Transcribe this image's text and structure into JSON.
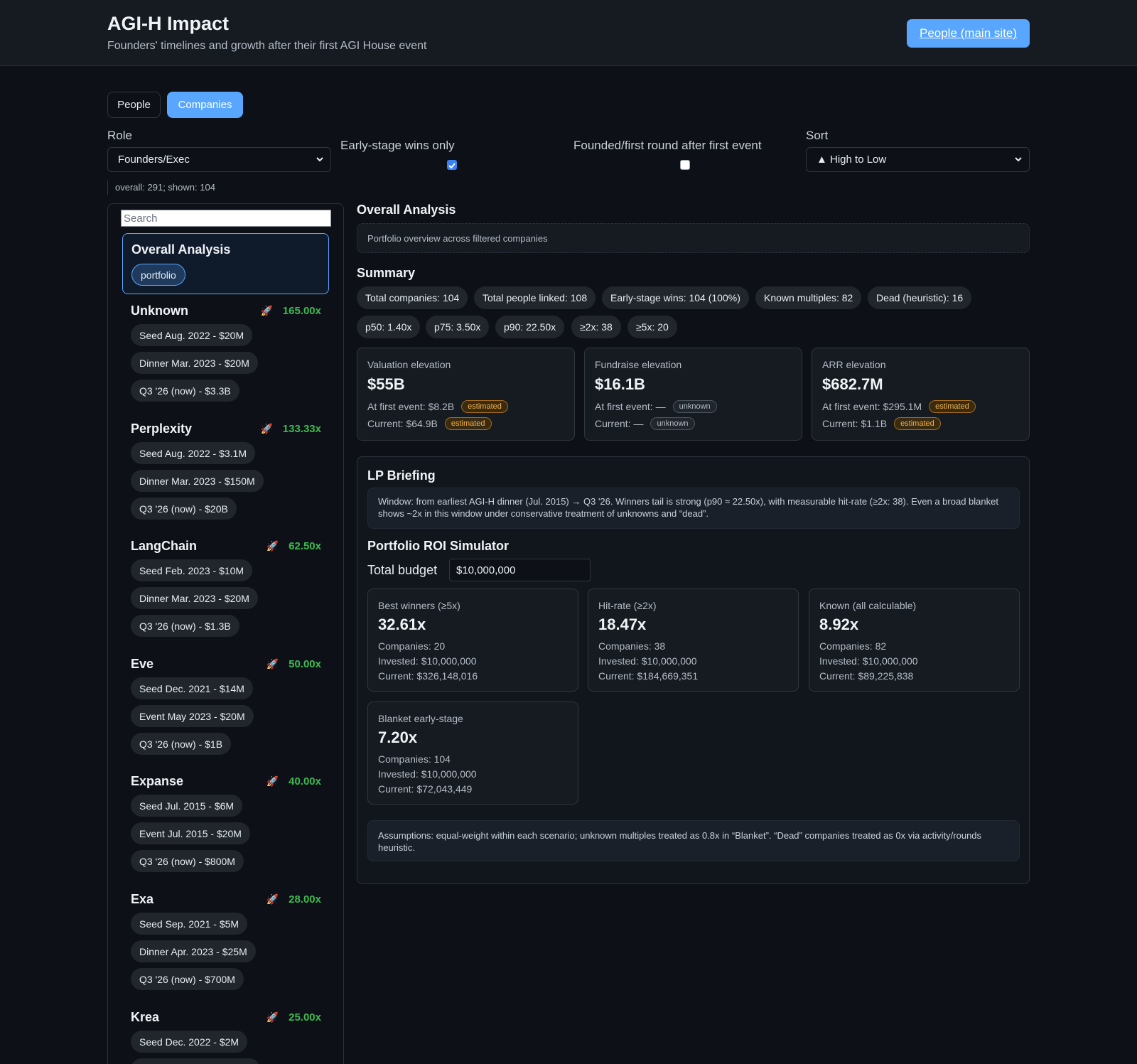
{
  "header": {
    "title": "AGI-H Impact",
    "subtitle": "Founders' timelines and growth after their first AGI House event",
    "main_site_link": "People (main site)"
  },
  "tabs": [
    {
      "label": "People",
      "active": false
    },
    {
      "label": "Companies",
      "active": true
    }
  ],
  "filters": {
    "role_label": "Role",
    "role_value": "Founders/Exec",
    "early_stage_label": "Early-stage wins only",
    "early_stage_checked": true,
    "founded_after_label": "Founded/first round after first event",
    "founded_after_checked": false,
    "sort_label": "Sort",
    "sort_value": "▲ High to Low"
  },
  "counts": "overall: 291; shown: 104",
  "sidebar": {
    "search_placeholder": "Search",
    "overall": {
      "title": "Overall Analysis",
      "tag": "portfolio"
    },
    "companies": [
      {
        "name": "Unknown",
        "multiple": "165.00x",
        "rounds": [
          "Seed Aug. 2022 - $20M",
          "Dinner Mar. 2023 - $20M",
          "Q3 '26 (now) - $3.3B"
        ]
      },
      {
        "name": "Perplexity",
        "multiple": "133.33x",
        "rounds": [
          "Seed Aug. 2022 - $3.1M",
          "Dinner Mar. 2023 - $150M",
          "Q3 '26 (now) - $20B"
        ]
      },
      {
        "name": "LangChain",
        "multiple": "62.50x",
        "rounds": [
          "Seed Feb. 2023 - $10M",
          "Dinner Mar. 2023 - $20M",
          "Q3 '26 (now) - $1.3B"
        ]
      },
      {
        "name": "Eve",
        "multiple": "50.00x",
        "rounds": [
          "Seed Dec. 2021 - $14M",
          "Event May 2023 - $20M",
          "Q3 '26 (now) - $1B"
        ]
      },
      {
        "name": "Expanse",
        "multiple": "40.00x",
        "rounds": [
          "Seed Jul. 2015 - $6M",
          "Event Jul. 2015 - $20M",
          "Q3 '26 (now) - $800M"
        ]
      },
      {
        "name": "Exa",
        "multiple": "28.00x",
        "rounds": [
          "Seed Sep. 2021 - $5M",
          "Dinner Apr. 2023 - $25M",
          "Q3 '26 (now) - $700M"
        ]
      },
      {
        "name": "Krea",
        "multiple": "25.00x",
        "rounds": [
          "Seed Dec. 2022 - $2M"
        ]
      }
    ]
  },
  "main": {
    "overall_title": "Overall Analysis",
    "overview_text": "Portfolio overview across filtered companies",
    "summary_title": "Summary",
    "summary_pills": [
      "Total companies: 104",
      "Total people linked: 108",
      "Early-stage wins: 104 (100%)",
      "Known multiples: 82",
      "Dead (heuristic): 16",
      "p50: 1.40x",
      "p75: 3.50x",
      "p90: 22.50x",
      "≥2x: 38",
      "≥5x: 20"
    ],
    "metrics": [
      {
        "label": "Valuation elevation",
        "value": "$55B",
        "first": "At first event: $8.2B",
        "first_badge": "estimated",
        "current": "Current: $64.9B",
        "current_badge": "estimated"
      },
      {
        "label": "Fundraise elevation",
        "value": "$16.1B",
        "first": "At first event: —",
        "first_badge": "unknown",
        "current": "Current: —",
        "current_badge": "unknown"
      },
      {
        "label": "ARR elevation",
        "value": "$682.7M",
        "first": "At first event: $295.1M",
        "first_badge": "estimated",
        "current": "Current: $1.1B",
        "current_badge": "estimated"
      }
    ],
    "lp": {
      "title": "LP Briefing",
      "window_text": "Window: from earliest AGI-H dinner (Jul. 2015) → Q3 '26. Winners tail is strong (p90 ≈ 22.50x), with measurable hit-rate (≥2x: 38). Even a broad blanket shows ~2x in this window under conservative treatment of unknowns and “dead”.",
      "roi_title": "Portfolio ROI Simulator",
      "budget_label": "Total budget",
      "budget_value": "$10,000,000",
      "scenarios": [
        {
          "label": "Best winners (≥5x)",
          "value": "32.61x",
          "companies": "Companies: 20",
          "invested": "Invested: $10,000,000",
          "current": "Current: $326,148,016"
        },
        {
          "label": "Hit-rate (≥2x)",
          "value": "18.47x",
          "companies": "Companies: 38",
          "invested": "Invested: $10,000,000",
          "current": "Current: $184,669,351"
        },
        {
          "label": "Known (all calculable)",
          "value": "8.92x",
          "companies": "Companies: 82",
          "invested": "Invested: $10,000,000",
          "current": "Current: $89,225,838"
        },
        {
          "label": "Blanket early-stage",
          "value": "7.20x",
          "companies": "Companies: 104",
          "invested": "Invested: $10,000,000",
          "current": "Current: $72,043,449"
        }
      ],
      "assumptions": "Assumptions: equal-weight within each scenario; unknown multiples treated as 0.8x in “Blanket”. “Dead” companies treated as 0x via activity/rounds heuristic."
    }
  },
  "icons": {
    "rocket": "🚀",
    "chevron": "chevron-down-icon"
  },
  "colors": {
    "accent": "#58a6ff",
    "positive": "#3fb950",
    "estimated": "#f0b34a",
    "background": "#0d1117"
  }
}
